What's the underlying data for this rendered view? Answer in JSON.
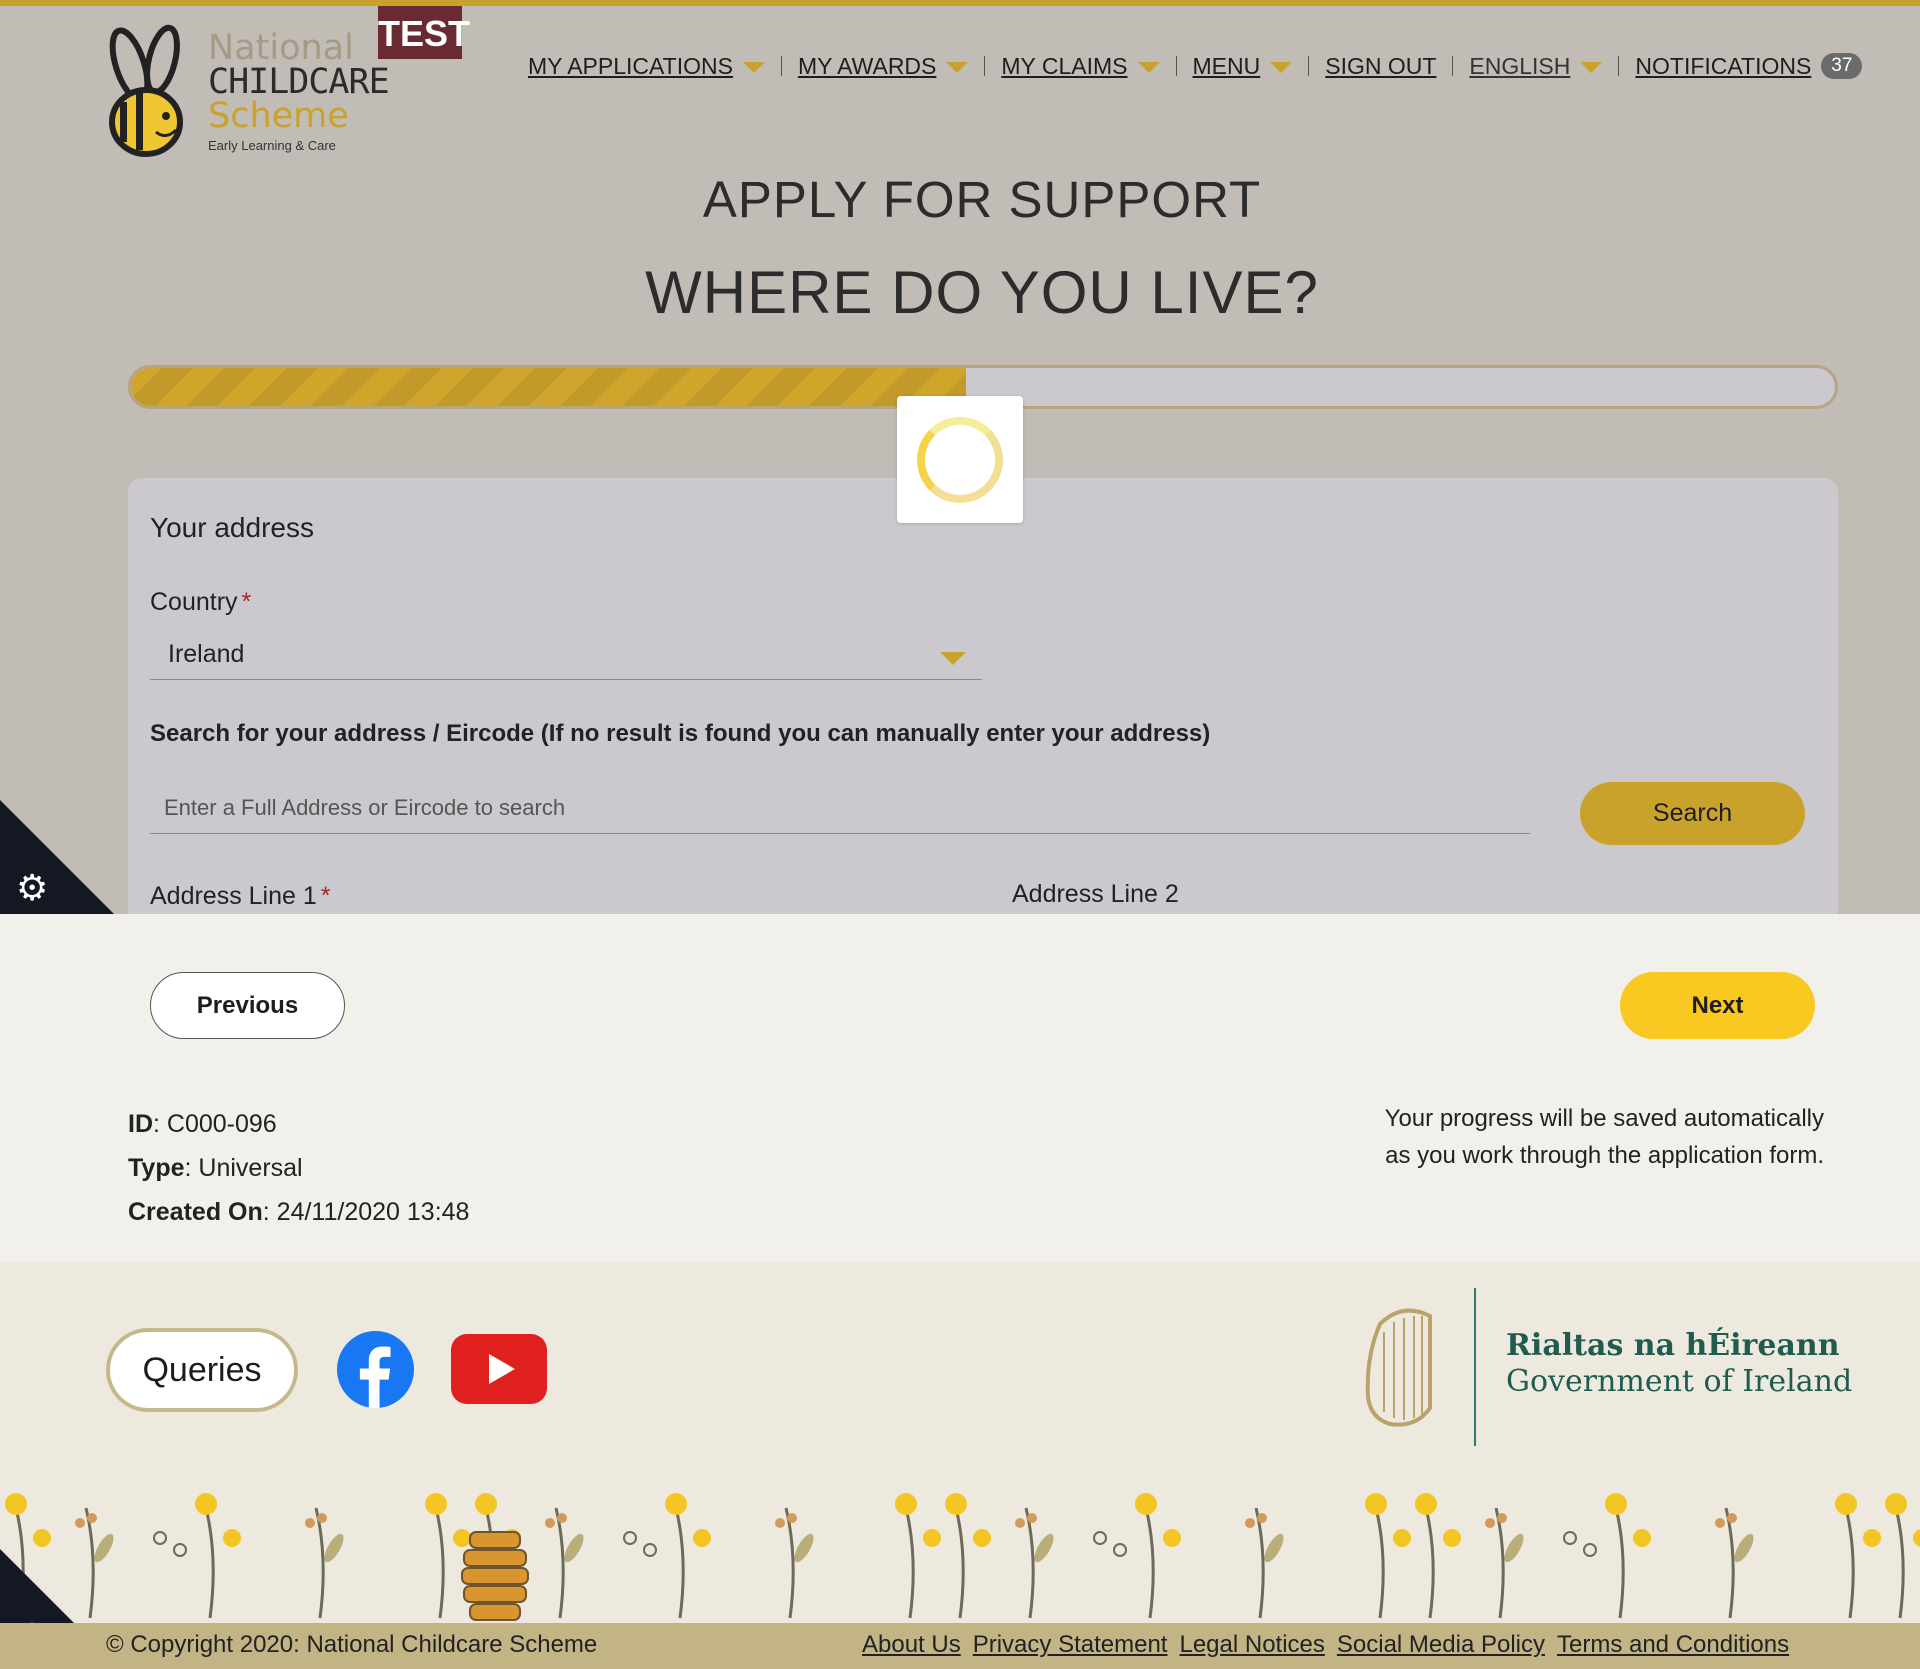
{
  "header": {
    "logo_text": {
      "line1": "National",
      "line2": "CHILDCARE",
      "line3": "Scheme",
      "line4": "Early Learning & Care"
    },
    "env_badge": "TEST",
    "nav": [
      {
        "label": "MY APPLICATIONS",
        "dropdown": true
      },
      {
        "label": "MY AWARDS",
        "dropdown": true
      },
      {
        "label": "MY CLAIMS",
        "dropdown": true
      },
      {
        "label": "MENU",
        "dropdown": true
      },
      {
        "label": "SIGN OUT",
        "dropdown": false
      },
      {
        "label": "ENGLISH",
        "dropdown": true
      },
      {
        "label": "NOTIFICATIONS",
        "dropdown": false
      }
    ],
    "notifications_count": "37"
  },
  "page": {
    "title": "APPLY FOR SUPPORT",
    "heading": "WHERE DO YOU LIVE?",
    "progress_fraction": 0.49
  },
  "address_form": {
    "section_title": "Your address",
    "country_label": "Country",
    "required_marker": "*",
    "country_value": "Ireland",
    "search_label": "Search for your address / Eircode (If no result is found you can manually enter your address)",
    "search_placeholder": "Enter a Full Address or Eircode to search",
    "search_button": "Search",
    "address_line1_label": "Address Line 1",
    "address_line2_label": "Address Line 2"
  },
  "navigation": {
    "previous_label": "Previous",
    "next_label": "Next"
  },
  "application_meta": {
    "id_label": "ID",
    "id_value": "C000-096",
    "type_label": "Type",
    "type_value": "Universal",
    "created_label": "Created On",
    "created_value": "24/11/2020 13:48"
  },
  "autosave_note": {
    "line1": "Your progress will be saved automatically",
    "line2": "as you work through the application form."
  },
  "footer": {
    "queries_label": "Queries",
    "gov_irish": "Rialtas na hÉireann",
    "gov_english": "Government of Ireland",
    "copyright": "© Copyright 2020: National Childcare Scheme",
    "links": [
      "About Us",
      "Privacy Statement",
      "Legal Notices",
      "Social Media Policy",
      "Terms and Conditions"
    ]
  },
  "colors": {
    "accent": "#c9a22b",
    "next_button": "#f9c821",
    "gov_green": "#1f5c4f",
    "test_badge": "#6a2a32"
  },
  "icons": [
    "bee-logo",
    "chevron-down-icon",
    "spinner-icon",
    "cookie-settings-gear-icon",
    "facebook-icon",
    "youtube-icon",
    "harp-icon",
    "beehive-icon"
  ]
}
